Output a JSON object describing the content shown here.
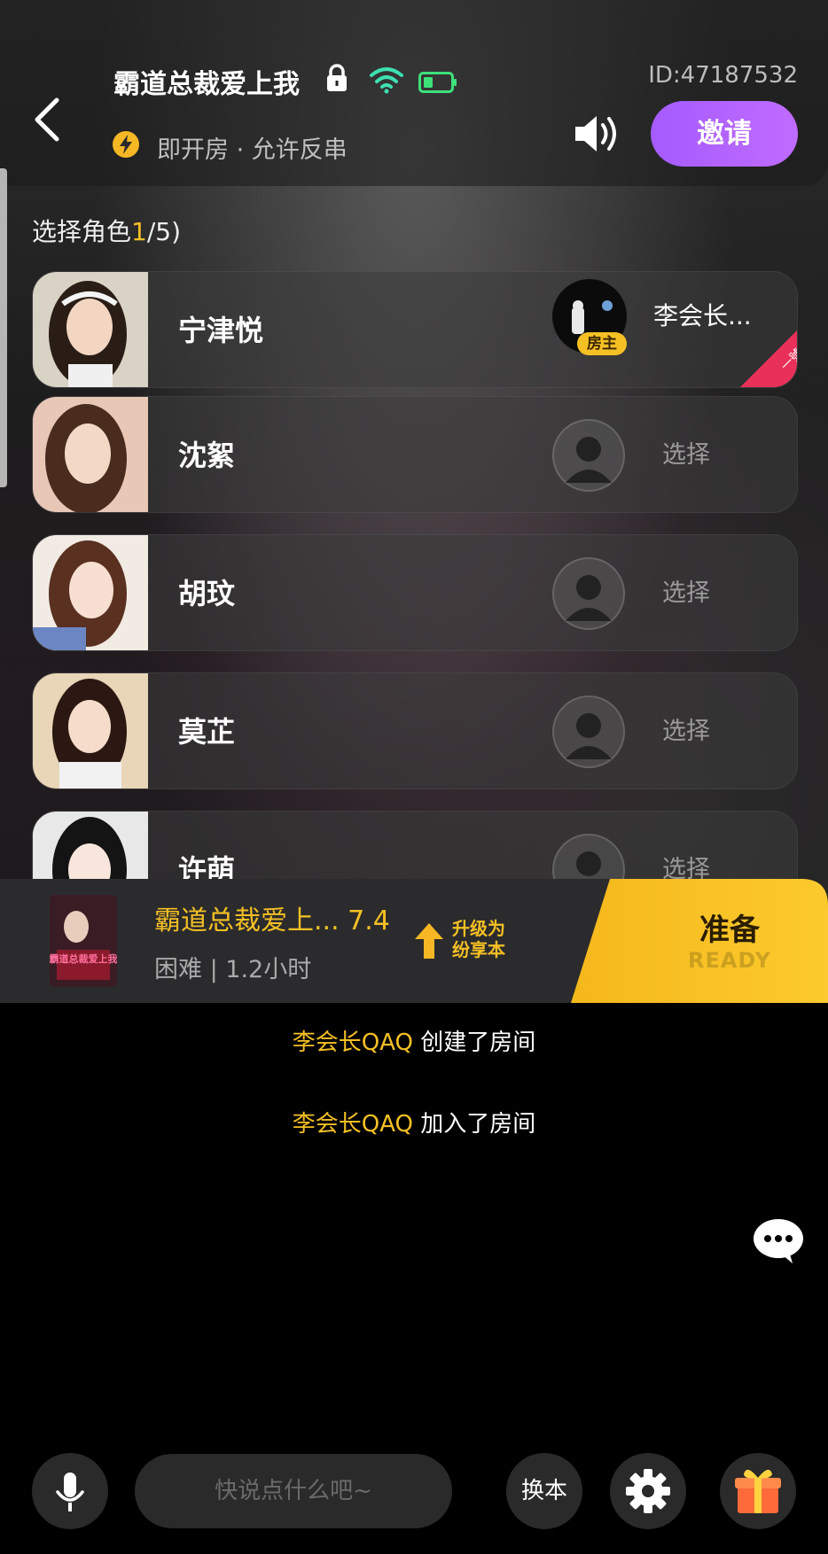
{
  "header": {
    "room_title": "霸道总裁爱上我",
    "room_id": "ID:47187532",
    "room_status": "即开房 · 允许反串",
    "invite_label": "邀请"
  },
  "role_select": {
    "title_prefix": "选择角色",
    "selected_count": "1",
    "title_suffix": "/5)"
  },
  "roles": [
    {
      "name": "宁津悦",
      "host_name": "李会长...",
      "host_badge": "房主",
      "corner_tag": "一號",
      "state": "taken"
    },
    {
      "name": "沈絮",
      "action": "选择",
      "state": "open"
    },
    {
      "name": "胡玟",
      "action": "选择",
      "state": "open"
    },
    {
      "name": "莫芷",
      "action": "选择",
      "state": "open"
    },
    {
      "name": "许萌",
      "action": "选择",
      "state": "open"
    }
  ],
  "book": {
    "title": "霸道总裁爱上... 7.4",
    "meta": "困难 | 1.2小时",
    "cover_text": "霸道总裁爱上我",
    "upgrade_label": "升级为纷享本",
    "ready_label": "准备",
    "ready_sub": "READY"
  },
  "chat_log": [
    {
      "user": "李会长QAQ",
      "text": " 创建了房间"
    },
    {
      "user": "李会长QAQ",
      "text": " 加入了房间"
    }
  ],
  "bottom": {
    "input_placeholder": "快说点什么吧~",
    "swap_label": "换本"
  },
  "colors": {
    "accent_gold": "#f5c024",
    "invite_purple": "#b062ff",
    "background": "#000000"
  },
  "icons": [
    "back-icon",
    "lock-icon",
    "wifi-icon",
    "battery-icon",
    "bolt-icon",
    "speaker-icon",
    "upgrade-arrow-icon",
    "chat-bubble-icon",
    "mic-icon",
    "settings-icon",
    "gift-icon"
  ]
}
